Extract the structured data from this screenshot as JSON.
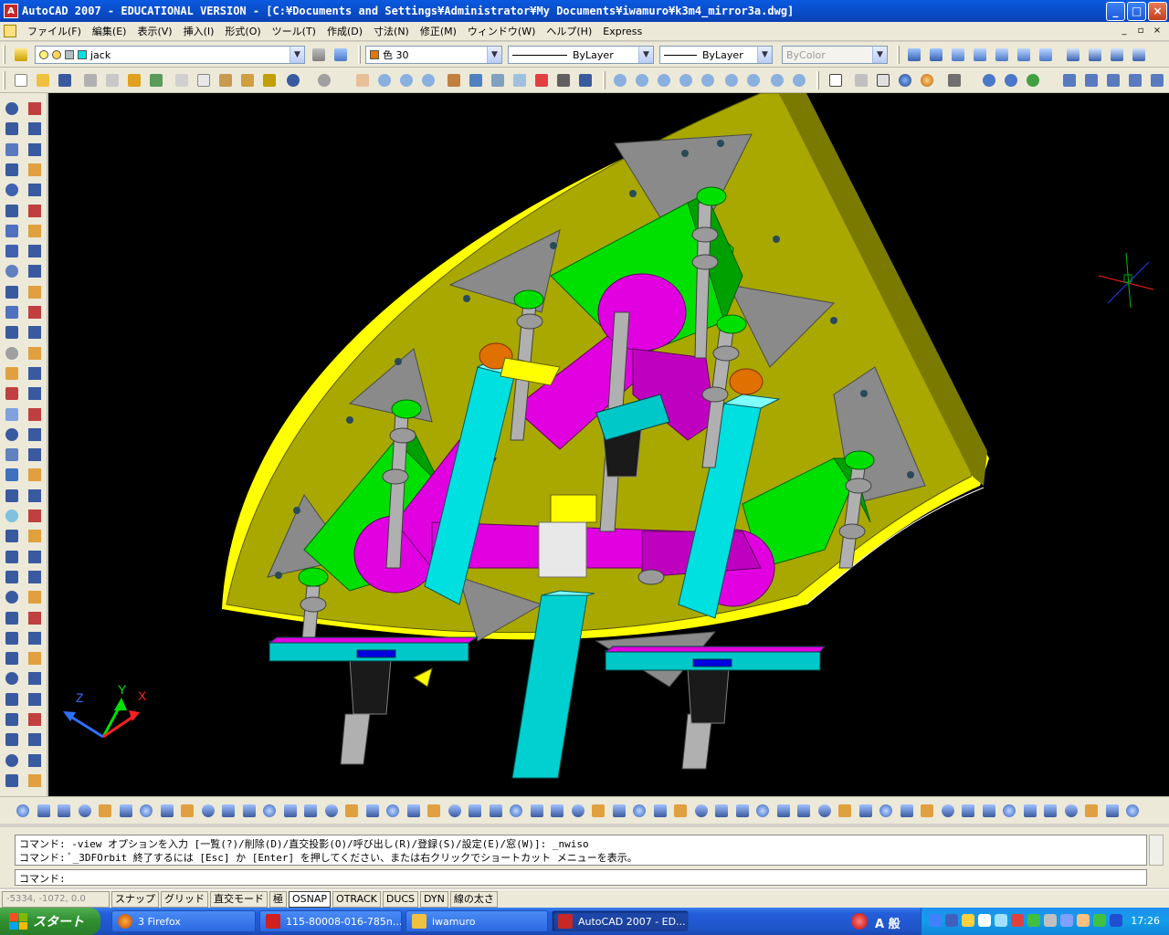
{
  "window": {
    "title": "AutoCAD 2007 - EDUCATIONAL VERSION - [C:¥Documents and Settings¥Administrator¥My Documents¥iwamuro¥k3m4_mirror3a.dwg]",
    "minimize": "_",
    "maximize": "□",
    "close": "×"
  },
  "menu": {
    "items": [
      "ファイル(F)",
      "編集(E)",
      "表示(V)",
      "挿入(I)",
      "形式(O)",
      "ツール(T)",
      "作成(D)",
      "寸法(N)",
      "修正(M)",
      "ウィンドウ(W)",
      "ヘルプ(H)",
      "Express"
    ],
    "mdi_min": "_",
    "mdi_restore": "▫",
    "mdi_close": "×"
  },
  "properties": {
    "layer": "jack",
    "color": "色 30",
    "color_hex": "#e07800",
    "linetype": "ByLayer",
    "lineweight": "ByLayer",
    "plotstyle": "ByColor"
  },
  "command": {
    "history": [
      "コマンド: -view オプションを入力 [一覧(?)/削除(D)/直交投影(O)/呼び出し(R)/登録(S)/設定(E)/窓(W)]: _nwiso",
      "コマンド: ﾞ_3DFOrbit 終了するには [Esc] か [Enter] を押してください、または右クリックでショートカット メニューを表示。"
    ],
    "prompt": "コマンド:"
  },
  "status": {
    "coords": "-5334, -1072, 0.0",
    "buttons": [
      {
        "label": "スナップ",
        "on": false
      },
      {
        "label": "グリッド",
        "on": false
      },
      {
        "label": "直交モード",
        "on": false
      },
      {
        "label": "極",
        "on": false
      },
      {
        "label": "OSNAP",
        "on": true
      },
      {
        "label": "OTRACK",
        "on": false
      },
      {
        "label": "DUCS",
        "on": false
      },
      {
        "label": "DYN",
        "on": false
      },
      {
        "label": "線の太さ",
        "on": false
      }
    ]
  },
  "ucs": {
    "x_label": "X",
    "y_label": "Y",
    "z_label": "Z"
  },
  "taskbar": {
    "start": "スタート",
    "tasks": [
      {
        "label": "3 Firefox",
        "active": false
      },
      {
        "label": "115-80008-016-785n...",
        "active": false
      },
      {
        "label": "iwamuro",
        "active": false
      },
      {
        "label": "AutoCAD 2007 - ED...",
        "active": true
      }
    ],
    "ime": "A 般",
    "clock": "17:26"
  },
  "colors": {
    "viewport_bg": "#000000",
    "plate": "#a8a800",
    "plate_edge": "#ffff00",
    "gray_plates": "#8a8a8a",
    "green": "#00e000",
    "magenta": "#e000e0",
    "cyan": "#00d8d8",
    "orange": "#e07000"
  }
}
